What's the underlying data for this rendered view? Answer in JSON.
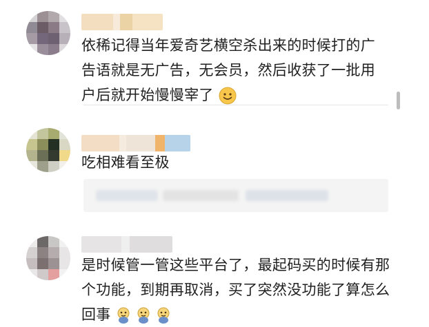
{
  "comments": [
    {
      "text_lines": [
        "依稀记得当年爱奇艺横空杀出来的时候打的广",
        "告语就是无广告，无会员，然后收获了一批用",
        "户后就开始慢慢宰了"
      ],
      "trailing_emoji": "smile-emoji"
    },
    {
      "text_lines": [
        "吃相难看至极"
      ]
    },
    {
      "text_lines": [
        "是时候管一管这些平台了，最起码买的时候有那",
        "个功能，到期再取消，买了突然没功能了算怎么",
        "回事"
      ],
      "trailing_emojis": [
        "doge-emoji",
        "doge-emoji",
        "doge-emoji"
      ]
    }
  ],
  "colors": {
    "background": "#ffffff",
    "text": "#1f1f1f",
    "reply_background": "#f4f4f4",
    "emoji_yellow": "#f7c64a"
  }
}
